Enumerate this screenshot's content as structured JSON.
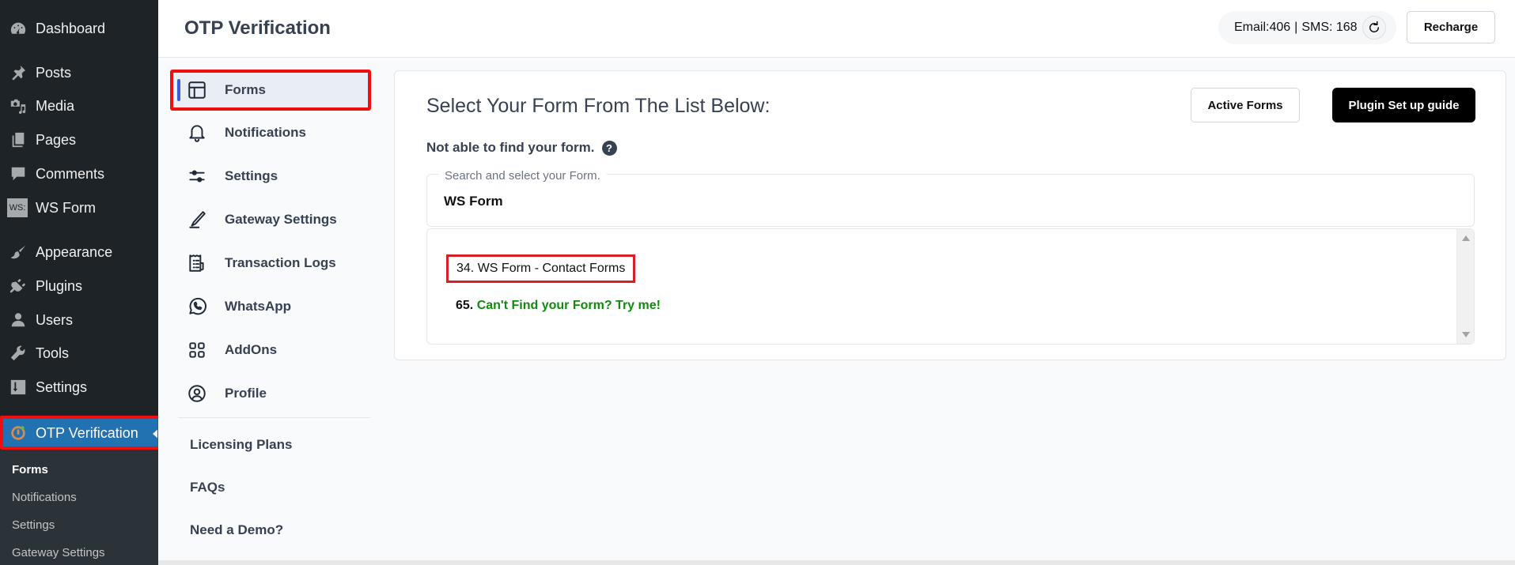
{
  "wp_sidebar": {
    "items": [
      {
        "label": "Dashboard",
        "icon": "dashboard-icon"
      },
      {
        "label": "Posts",
        "icon": "pin-icon"
      },
      {
        "label": "Media",
        "icon": "media-icon"
      },
      {
        "label": "Pages",
        "icon": "pages-icon"
      },
      {
        "label": "Comments",
        "icon": "comment-icon"
      },
      {
        "label": "WS Form",
        "icon": "ws-form-icon"
      },
      {
        "label": "Appearance",
        "icon": "paintbrush-icon"
      },
      {
        "label": "Plugins",
        "icon": "plug-icon"
      },
      {
        "label": "Users",
        "icon": "user-icon"
      },
      {
        "label": "Tools",
        "icon": "wrench-icon"
      },
      {
        "label": "Settings",
        "icon": "settings-sliders-icon"
      }
    ],
    "active": {
      "label": "OTP Verification",
      "icon": "otp-icon"
    },
    "ws_badge": "WS:",
    "submenu": [
      {
        "label": "Forms",
        "current": true
      },
      {
        "label": "Notifications"
      },
      {
        "label": "Settings"
      },
      {
        "label": "Gateway Settings"
      }
    ]
  },
  "header": {
    "title": "OTP Verification",
    "balance": {
      "email_label": "Email:406",
      "separator": "|",
      "sms_label": "SMS: 168"
    },
    "recharge_label": "Recharge"
  },
  "plugin_nav": {
    "items": [
      {
        "label": "Forms",
        "icon": "forms-layout-icon",
        "active": true
      },
      {
        "label": "Notifications",
        "icon": "bell-icon"
      },
      {
        "label": "Settings",
        "icon": "sliders-icon"
      },
      {
        "label": "Gateway Settings",
        "icon": "pen-icon"
      },
      {
        "label": "Transaction Logs",
        "icon": "receipt-icon"
      },
      {
        "label": "WhatsApp",
        "icon": "whatsapp-icon"
      },
      {
        "label": "AddOns",
        "icon": "grid-icon"
      },
      {
        "label": "Profile",
        "icon": "profile-icon"
      }
    ],
    "links": [
      "Licensing Plans",
      "FAQs",
      "Need a Demo?"
    ]
  },
  "main": {
    "title": "Select Your Form From The List Below:",
    "active_forms_label": "Active Forms",
    "guide_label": "Plugin Set up guide",
    "help_text": "Not able to find your form.",
    "help_icon": "?",
    "search": {
      "label": "Search and select your Form.",
      "value": "WS Form"
    },
    "options": [
      {
        "number": "34.",
        "label": "WS Form - Contact Forms",
        "highlighted": true
      },
      {
        "number": "65.",
        "label": "Can't Find your Form? Try me!",
        "color": "#118a0f"
      }
    ]
  },
  "colors": {
    "wp_sidebar_bg": "#1d2327",
    "wp_active": "#2271b1",
    "highlight_red": "#f00f0f",
    "try_me_green": "#118a0f",
    "guide_button_bg": "#000000"
  }
}
